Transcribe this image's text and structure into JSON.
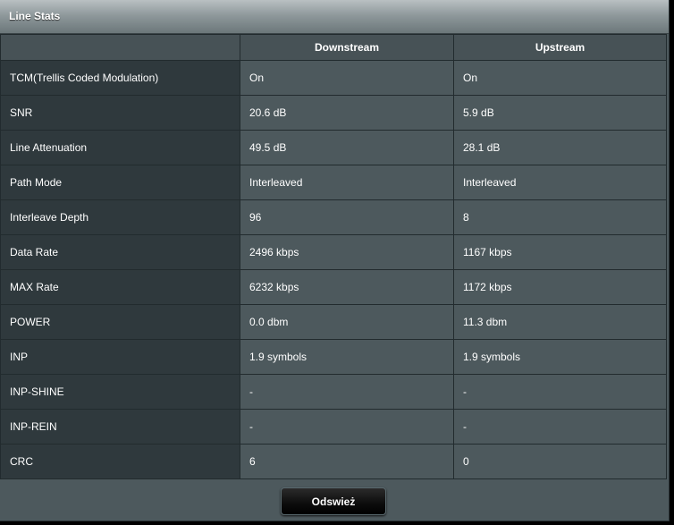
{
  "panel": {
    "title": "Line Stats"
  },
  "table": {
    "headers": [
      "",
      "Downstream",
      "Upstream"
    ],
    "rows": [
      {
        "label": "TCM(Trellis Coded Modulation)",
        "downstream": "On",
        "upstream": "On"
      },
      {
        "label": "SNR",
        "downstream": "20.6 dB",
        "upstream": "5.9 dB"
      },
      {
        "label": "Line Attenuation",
        "downstream": "49.5 dB",
        "upstream": "28.1 dB"
      },
      {
        "label": "Path Mode",
        "downstream": "Interleaved",
        "upstream": "Interleaved"
      },
      {
        "label": "Interleave Depth",
        "downstream": "96",
        "upstream": "8"
      },
      {
        "label": "Data Rate",
        "downstream": "2496 kbps",
        "upstream": "1167 kbps"
      },
      {
        "label": "MAX Rate",
        "downstream": "6232 kbps",
        "upstream": "1172 kbps"
      },
      {
        "label": "POWER",
        "downstream": "0.0 dbm",
        "upstream": "11.3 dbm"
      },
      {
        "label": "INP",
        "downstream": "1.9 symbols",
        "upstream": "1.9 symbols"
      },
      {
        "label": "INP-SHINE",
        "downstream": "-",
        "upstream": "-"
      },
      {
        "label": "INP-REIN",
        "downstream": "-",
        "upstream": "-"
      },
      {
        "label": "CRC",
        "downstream": "6",
        "upstream": "0"
      }
    ]
  },
  "footer": {
    "refresh_label": "Odswież"
  },
  "colors": {
    "panel_bg": "#4d595d",
    "label_bg": "#2f393d",
    "border": "#222b2e",
    "text": "#ffffff"
  }
}
